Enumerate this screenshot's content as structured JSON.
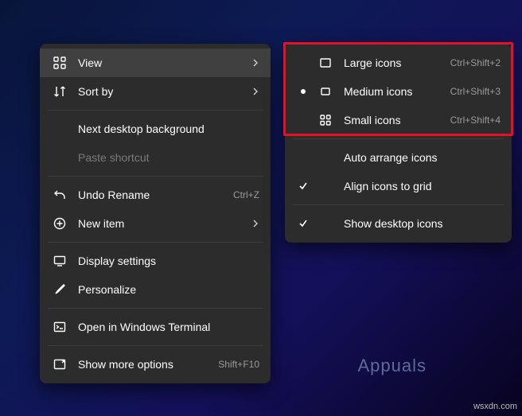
{
  "main_menu": {
    "items": [
      {
        "label": "View",
        "accel": "",
        "has_submenu": true,
        "highlight": true
      },
      {
        "label": "Sort by",
        "accel": "",
        "has_submenu": true
      },
      null,
      {
        "label": "Next desktop background",
        "accel": ""
      },
      {
        "label": "Paste shortcut",
        "accel": "",
        "disabled": true
      },
      null,
      {
        "label": "Undo Rename",
        "accel": "Ctrl+Z"
      },
      {
        "label": "New item",
        "accel": "",
        "has_submenu": true
      },
      null,
      {
        "label": "Display settings",
        "accel": ""
      },
      {
        "label": "Personalize",
        "accel": ""
      },
      null,
      {
        "label": "Open in Windows Terminal",
        "accel": ""
      },
      null,
      {
        "label": "Show more options",
        "accel": "Shift+F10"
      }
    ]
  },
  "sub_menu": {
    "items": [
      {
        "label": "Large icons",
        "accel": "Ctrl+Shift+2",
        "selected": false
      },
      {
        "label": "Medium icons",
        "accel": "Ctrl+Shift+3",
        "selected": true
      },
      {
        "label": "Small icons",
        "accel": "Ctrl+Shift+4",
        "selected": false
      },
      null,
      {
        "label": "Auto arrange icons",
        "checked": false
      },
      {
        "label": "Align icons to grid",
        "checked": true
      },
      null,
      {
        "label": "Show desktop icons",
        "checked": true
      }
    ]
  },
  "watermark": "wsxdn.com",
  "logo": "Appuals"
}
